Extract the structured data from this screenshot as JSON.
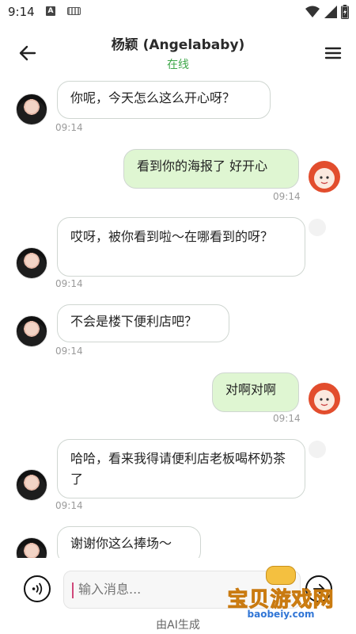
{
  "status_bar": {
    "time": "9:14",
    "a_icon_letter": "A"
  },
  "header": {
    "title": "杨颖 (Angelababy)",
    "status": "在线"
  },
  "messages": [
    {
      "side": "in",
      "text": "你呢，今天怎么这么开心呀？",
      "time": "09:14"
    },
    {
      "side": "out",
      "text": "看到你的海报了 好开心",
      "time": "09:14"
    },
    {
      "side": "in",
      "text": "哎呀，被你看到啦～在哪看到的呀？",
      "time": "09:14"
    },
    {
      "side": "in",
      "text": "不会是楼下便利店吧？",
      "time": "09:14"
    },
    {
      "side": "out",
      "text": "对啊对啊",
      "time": "09:14"
    },
    {
      "side": "in",
      "text": "哈哈，看来我得请便利店老板喝杯奶茶了",
      "time": "09:14"
    },
    {
      "side": "in",
      "text": "谢谢你这么捧场～",
      "time": ""
    }
  ],
  "input": {
    "placeholder": "输入消息..."
  },
  "footer": {
    "ai_label": "由AI生成"
  },
  "watermark": {
    "text": "宝贝游戏网",
    "url": "baobeiy.com"
  },
  "colors": {
    "accent_green": "#3fa84a",
    "out_bubble": "#dff6d2",
    "in_bubble": "#ffffff"
  }
}
